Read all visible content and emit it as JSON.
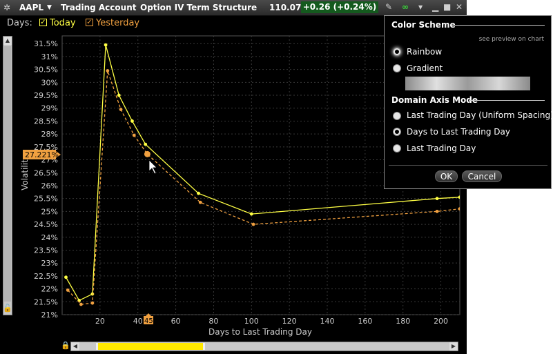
{
  "title_bar": {
    "symbol": "AAPL",
    "account": "Trading Account",
    "window_title": "Option IV Term Structure",
    "price": "110.07",
    "change": "+0.26 (+0.24%)"
  },
  "legend_toolbar": {
    "days_label": "Days:",
    "today_label": "Today",
    "yesterday_label": "Yesterday",
    "today_color": "#ffff44",
    "yesterday_color": "#f0a040"
  },
  "cursor_readout": {
    "y_value": "27.221%",
    "x_value": "45"
  },
  "chart_data": {
    "type": "line",
    "xlabel": "Days to Last Trading Day",
    "ylabel": "Volatility",
    "xlim": [
      0,
      210
    ],
    "ylim": [
      21,
      31.8
    ],
    "x_ticks": [
      20,
      40,
      60,
      80,
      100,
      120,
      140,
      160,
      180,
      200
    ],
    "y_ticks": [
      21,
      21.5,
      22,
      22.5,
      23,
      23.5,
      24,
      24.5,
      25,
      25.5,
      26,
      26.5,
      27,
      27.5,
      28,
      28.5,
      29,
      29.5,
      30,
      30.5,
      31,
      31.5
    ],
    "grid": true,
    "series": [
      {
        "name": "Today",
        "color": "#ffff44",
        "style": "solid",
        "x": [
          2,
          9,
          16,
          23,
          30,
          37,
          44,
          72,
          100,
          198,
          210
        ],
        "y": [
          22.45,
          21.55,
          21.8,
          31.45,
          29.5,
          28.5,
          27.6,
          25.7,
          24.9,
          25.5,
          25.55
        ]
      },
      {
        "name": "Yesterday",
        "color": "#f0a040",
        "style": "dashed",
        "x": [
          3,
          10,
          16,
          24,
          31,
          38,
          45,
          73,
          101,
          198,
          210
        ],
        "y": [
          21.95,
          21.4,
          21.45,
          30.45,
          28.95,
          27.95,
          27.22,
          25.35,
          24.5,
          25.0,
          25.1
        ]
      }
    ]
  },
  "color_scheme_panel": {
    "heading": "Color Scheme",
    "preview_note": "see preview on chart",
    "options": [
      "Rainbow",
      "Gradient"
    ],
    "selected": "Rainbow",
    "axis_heading": "Domain Axis Mode",
    "axis_options": [
      "Last Trading Day (Uniform Spacing)",
      "Days to Last Trading Day",
      "Last Trading Day"
    ],
    "axis_selected": "Days to Last Trading Day",
    "ok_label": "OK",
    "cancel_label": "Cancel"
  }
}
